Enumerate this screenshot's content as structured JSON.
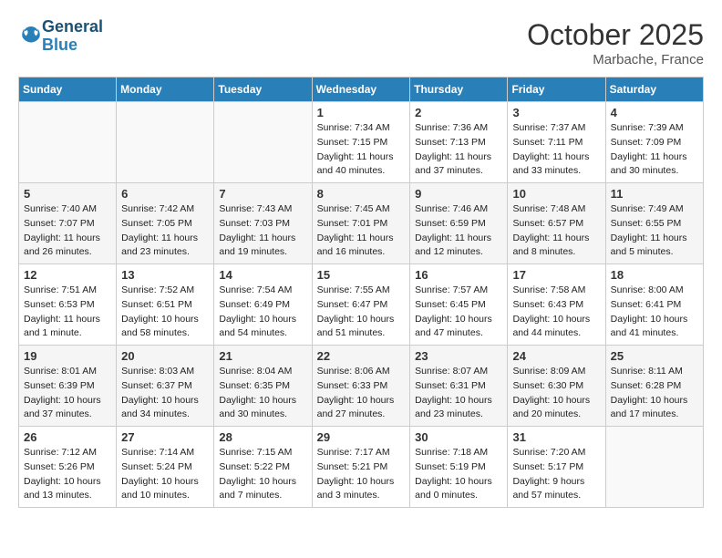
{
  "header": {
    "logo_line1": "General",
    "logo_line2": "Blue",
    "month": "October 2025",
    "location": "Marbache, France"
  },
  "days_of_week": [
    "Sunday",
    "Monday",
    "Tuesday",
    "Wednesday",
    "Thursday",
    "Friday",
    "Saturday"
  ],
  "weeks": [
    [
      {
        "day": "",
        "info": ""
      },
      {
        "day": "",
        "info": ""
      },
      {
        "day": "",
        "info": ""
      },
      {
        "day": "1",
        "info": "Sunrise: 7:34 AM\nSunset: 7:15 PM\nDaylight: 11 hours\nand 40 minutes."
      },
      {
        "day": "2",
        "info": "Sunrise: 7:36 AM\nSunset: 7:13 PM\nDaylight: 11 hours\nand 37 minutes."
      },
      {
        "day": "3",
        "info": "Sunrise: 7:37 AM\nSunset: 7:11 PM\nDaylight: 11 hours\nand 33 minutes."
      },
      {
        "day": "4",
        "info": "Sunrise: 7:39 AM\nSunset: 7:09 PM\nDaylight: 11 hours\nand 30 minutes."
      }
    ],
    [
      {
        "day": "5",
        "info": "Sunrise: 7:40 AM\nSunset: 7:07 PM\nDaylight: 11 hours\nand 26 minutes."
      },
      {
        "day": "6",
        "info": "Sunrise: 7:42 AM\nSunset: 7:05 PM\nDaylight: 11 hours\nand 23 minutes."
      },
      {
        "day": "7",
        "info": "Sunrise: 7:43 AM\nSunset: 7:03 PM\nDaylight: 11 hours\nand 19 minutes."
      },
      {
        "day": "8",
        "info": "Sunrise: 7:45 AM\nSunset: 7:01 PM\nDaylight: 11 hours\nand 16 minutes."
      },
      {
        "day": "9",
        "info": "Sunrise: 7:46 AM\nSunset: 6:59 PM\nDaylight: 11 hours\nand 12 minutes."
      },
      {
        "day": "10",
        "info": "Sunrise: 7:48 AM\nSunset: 6:57 PM\nDaylight: 11 hours\nand 8 minutes."
      },
      {
        "day": "11",
        "info": "Sunrise: 7:49 AM\nSunset: 6:55 PM\nDaylight: 11 hours\nand 5 minutes."
      }
    ],
    [
      {
        "day": "12",
        "info": "Sunrise: 7:51 AM\nSunset: 6:53 PM\nDaylight: 11 hours\nand 1 minute."
      },
      {
        "day": "13",
        "info": "Sunrise: 7:52 AM\nSunset: 6:51 PM\nDaylight: 10 hours\nand 58 minutes."
      },
      {
        "day": "14",
        "info": "Sunrise: 7:54 AM\nSunset: 6:49 PM\nDaylight: 10 hours\nand 54 minutes."
      },
      {
        "day": "15",
        "info": "Sunrise: 7:55 AM\nSunset: 6:47 PM\nDaylight: 10 hours\nand 51 minutes."
      },
      {
        "day": "16",
        "info": "Sunrise: 7:57 AM\nSunset: 6:45 PM\nDaylight: 10 hours\nand 47 minutes."
      },
      {
        "day": "17",
        "info": "Sunrise: 7:58 AM\nSunset: 6:43 PM\nDaylight: 10 hours\nand 44 minutes."
      },
      {
        "day": "18",
        "info": "Sunrise: 8:00 AM\nSunset: 6:41 PM\nDaylight: 10 hours\nand 41 minutes."
      }
    ],
    [
      {
        "day": "19",
        "info": "Sunrise: 8:01 AM\nSunset: 6:39 PM\nDaylight: 10 hours\nand 37 minutes."
      },
      {
        "day": "20",
        "info": "Sunrise: 8:03 AM\nSunset: 6:37 PM\nDaylight: 10 hours\nand 34 minutes."
      },
      {
        "day": "21",
        "info": "Sunrise: 8:04 AM\nSunset: 6:35 PM\nDaylight: 10 hours\nand 30 minutes."
      },
      {
        "day": "22",
        "info": "Sunrise: 8:06 AM\nSunset: 6:33 PM\nDaylight: 10 hours\nand 27 minutes."
      },
      {
        "day": "23",
        "info": "Sunrise: 8:07 AM\nSunset: 6:31 PM\nDaylight: 10 hours\nand 23 minutes."
      },
      {
        "day": "24",
        "info": "Sunrise: 8:09 AM\nSunset: 6:30 PM\nDaylight: 10 hours\nand 20 minutes."
      },
      {
        "day": "25",
        "info": "Sunrise: 8:11 AM\nSunset: 6:28 PM\nDaylight: 10 hours\nand 17 minutes."
      }
    ],
    [
      {
        "day": "26",
        "info": "Sunrise: 7:12 AM\nSunset: 5:26 PM\nDaylight: 10 hours\nand 13 minutes."
      },
      {
        "day": "27",
        "info": "Sunrise: 7:14 AM\nSunset: 5:24 PM\nDaylight: 10 hours\nand 10 minutes."
      },
      {
        "day": "28",
        "info": "Sunrise: 7:15 AM\nSunset: 5:22 PM\nDaylight: 10 hours\nand 7 minutes."
      },
      {
        "day": "29",
        "info": "Sunrise: 7:17 AM\nSunset: 5:21 PM\nDaylight: 10 hours\nand 3 minutes."
      },
      {
        "day": "30",
        "info": "Sunrise: 7:18 AM\nSunset: 5:19 PM\nDaylight: 10 hours\nand 0 minutes."
      },
      {
        "day": "31",
        "info": "Sunrise: 7:20 AM\nSunset: 5:17 PM\nDaylight: 9 hours\nand 57 minutes."
      },
      {
        "day": "",
        "info": ""
      }
    ]
  ]
}
